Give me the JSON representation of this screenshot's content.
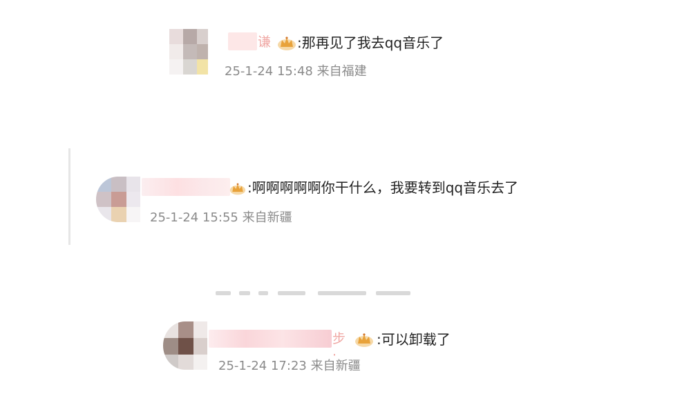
{
  "comments": [
    {
      "name_tail": "谦",
      "colon_text": ":那再见了我去qq音乐了",
      "meta": "25-1-24 15:48 来自福建"
    },
    {
      "name_tail": "",
      "colon_text": ":啊啊啊啊啊你干什么，我要转到qq音乐去了",
      "meta": "25-1-24 15:55 来自新疆"
    },
    {
      "name_tail": "步·",
      "colon_text": ":可以卸载了",
      "meta": "25-1-24 17:23 来自新疆"
    }
  ],
  "colors": {
    "text": "#222222",
    "meta": "#8a8a8a",
    "name_pink": "#f0a8a4",
    "crown_gold": "#e8a23a"
  },
  "icons": {
    "badge": "crown-badge-icon"
  }
}
